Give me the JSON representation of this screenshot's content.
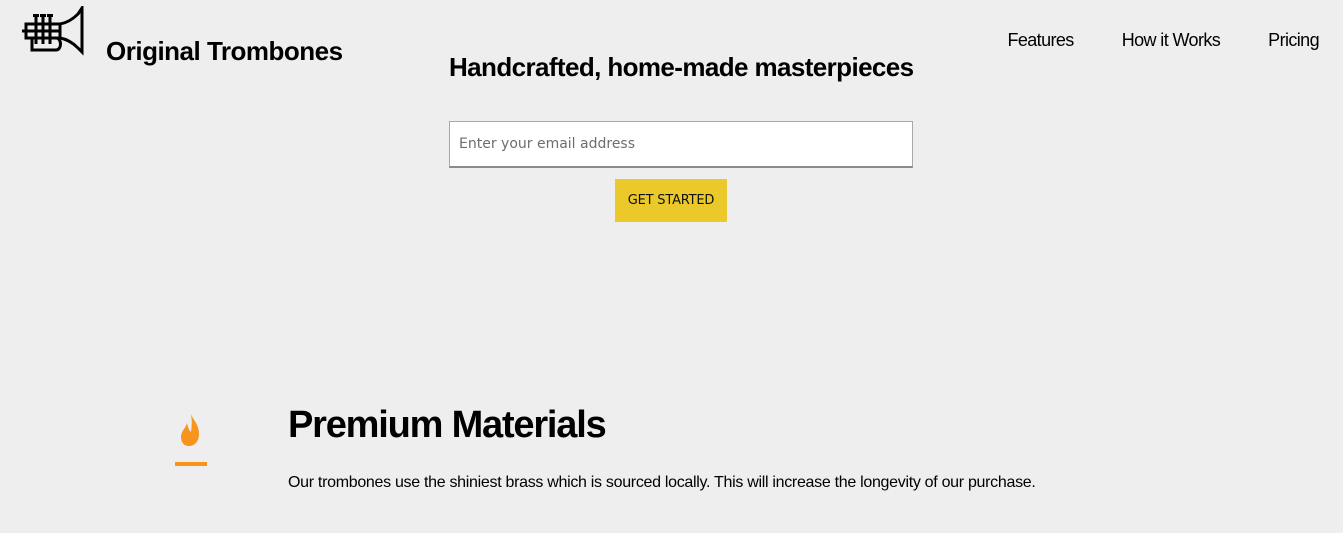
{
  "header": {
    "logo_icon": "trumpet-icon",
    "brand": "Original Trombones",
    "nav": [
      {
        "label": "Features"
      },
      {
        "label": "How it Works"
      },
      {
        "label": "Pricing"
      }
    ]
  },
  "hero": {
    "title": "Handcrafted, home-made masterpieces",
    "email_placeholder": "Enter your email address",
    "email_value": "",
    "cta_label": "GET STARTED"
  },
  "features": [
    {
      "icon": "flame-icon",
      "title": "Premium Materials",
      "description": "Our trombones use the shiniest brass which is sourced locally. This will increase the longevity of our purchase."
    }
  ],
  "colors": {
    "background": "#eeeeee",
    "cta": "#ecc92a",
    "flame": "#f7941d"
  }
}
